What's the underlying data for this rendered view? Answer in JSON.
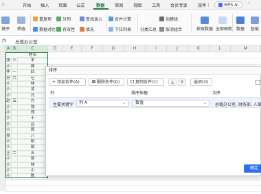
{
  "tabs": [
    "开始",
    "插入",
    "页面",
    "公式",
    "数据",
    "审阅",
    "视图",
    "工具",
    "会员专享",
    "效率"
  ],
  "active_tab": "数据",
  "wps_ai": "WPS AI",
  "ribbon": {
    "sort_label": "排序",
    "filter_label": "筛选",
    "duplicates_label": "重复项",
    "compare_label": "数据对比",
    "stock_label": "股票",
    "split_label": "分列",
    "validity_label": "有效性",
    "fill_label": "填充",
    "find_input_label": "查找录入",
    "dropdown_label": "下拉列表",
    "merge_calc_label": "合并计算",
    "simulation_label": "模拟分析",
    "subtotal_label": "分类汇总",
    "outline_label": "创建组",
    "ungroup_label": "取消组合",
    "get_data_label": "获取数据",
    "all_refresh_label": "全部刷新",
    "sheet_label": "数据",
    "more_label": "智能"
  },
  "formula_bar": {
    "fx": "fx",
    "value": "总裁办公室"
  },
  "grid": {
    "columns": [
      "A",
      "B",
      "C",
      "D",
      "E",
      "F",
      "G",
      "H",
      "I",
      "J",
      "K",
      "L",
      "M"
    ],
    "header_cell": "姓名",
    "names": [
      [
        "张",
        "三",
        "丰"
      ],
      [
        "小",
        "",
        "燕"
      ],
      [
        "李",
        "一",
        "四"
      ],
      [
        "孙",
        "六",
        "七"
      ],
      [
        "小",
        "",
        "林"
      ],
      [
        "小",
        "",
        "凌"
      ],
      [
        "小",
        "",
        "元"
      ],
      [
        "赵",
        "五",
        "方"
      ],
      [
        "小",
        "",
        "强"
      ],
      [
        "小",
        "",
        "郑"
      ],
      [
        "小",
        "",
        "十"
      ],
      [
        "小",
        "",
        "吕"
      ],
      [
        "小",
        "",
        "周"
      ],
      [
        "吴",
        "",
        "八"
      ],
      [
        "小",
        "",
        "阳"
      ],
      [
        "小",
        "",
        "晓"
      ],
      [
        "王",
        "二",
        "五"
      ],
      [
        "小",
        "",
        "吴"
      ],
      [
        "小",
        "",
        "林"
      ],
      [
        "小",
        "",
        "小"
      ],
      [
        "小",
        "",
        "陈"
      ]
    ]
  },
  "dialog": {
    "title": "排序",
    "add_condition": "添加条件(A)",
    "delete_condition": "删除条件(D)",
    "copy_condition": "复制条件(C)",
    "options": "选项(O)",
    "col_header": "列",
    "sort_basis_header": "排序依据",
    "order_header": "次序",
    "primary_key_label": "主要关键字",
    "column_value": "列 A",
    "basis_value": "数值",
    "order_value": "总裁办公室, 财务部, 人事部",
    "ok": "确定"
  }
}
